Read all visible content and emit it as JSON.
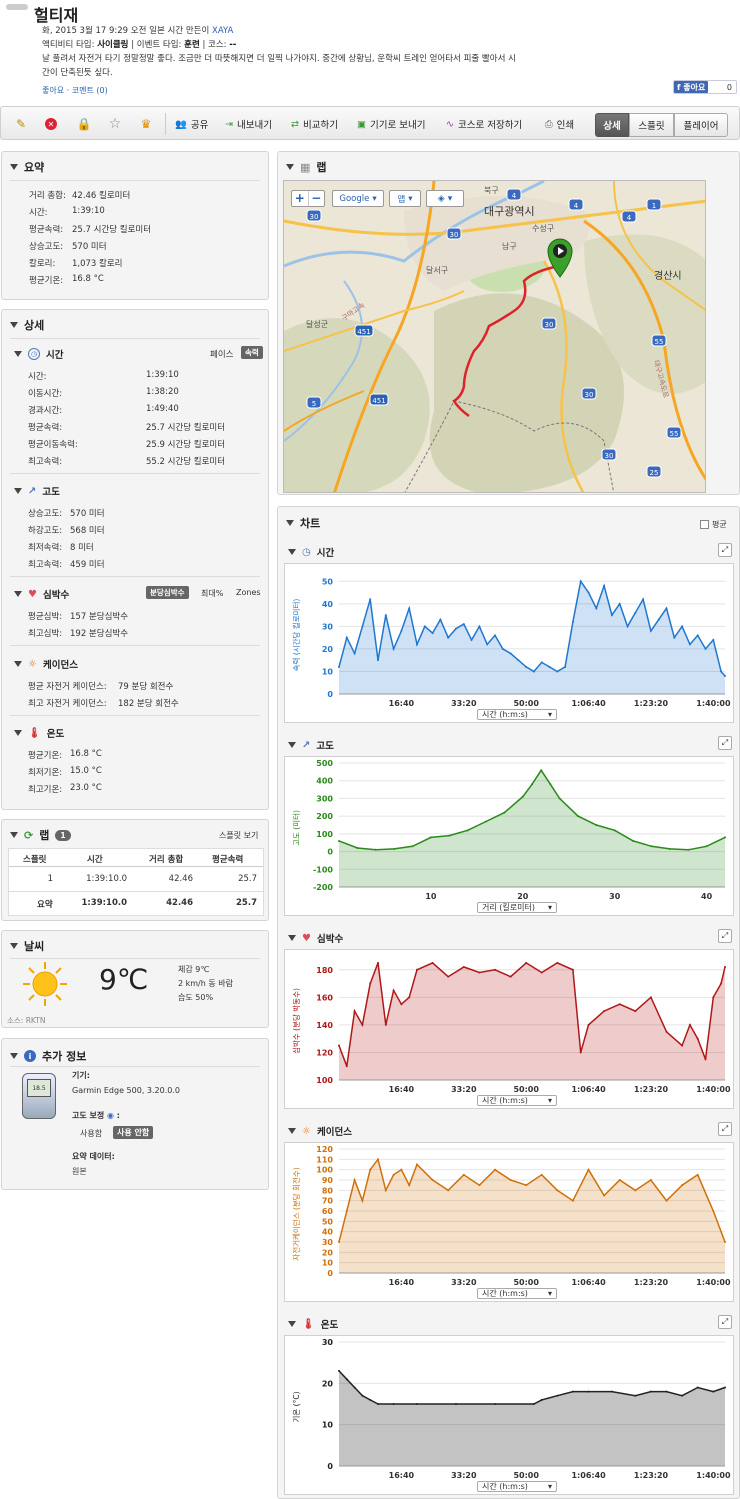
{
  "header": {
    "title": "헐티재",
    "meta_line": "화, 2015 3월 17 9:29 오전 일본 시간 만든이",
    "author": "XAYA",
    "activity_prefix": "액티비티 타입:",
    "activity_type": "사이클링",
    "event_prefix": "| 이벤트 타입:",
    "event_type": "훈련",
    "course_prefix": "| 코스:",
    "course": "--",
    "desc1": "날 풀려서 자전거 타기 정말정말 좋다. 조금만 더 따뜻해지면 더 일찍 나가야지. 중간에 상황님, 운학씨 트레인 얻어타서 피줄 빨아서 시",
    "desc2": "간이 단축된듯 싶다.",
    "like_link": "좋아요",
    "comment_link": "코멘트 (0)",
    "fb_like": "좋아요",
    "fb_count": "0"
  },
  "toolbar": {
    "share": "공유",
    "export": "내보내기",
    "compare": "비교하기",
    "send_device": "기기로 보내기",
    "save_course": "코스로 저장하기",
    "print": "인쇄",
    "tab_detail": "상세",
    "tab_split": "스플릿",
    "tab_player": "플레이어"
  },
  "summary": {
    "title": "요약",
    "rows": [
      {
        "k": "거리 총합:",
        "v": "42.46 킬로미터"
      },
      {
        "k": "시간:",
        "v": "1:39:10"
      },
      {
        "k": "평균속력:",
        "v": "25.7 시간당 킬로미터"
      },
      {
        "k": "상승고도:",
        "v": "570 미터"
      },
      {
        "k": "칼로리:",
        "v": "1,073 칼로리"
      },
      {
        "k": "평균기온:",
        "v": "16.8 °C"
      }
    ]
  },
  "details": {
    "title": "상세",
    "time": {
      "title": "시간",
      "opt1": "페이스",
      "opt2": "속력",
      "rows": [
        {
          "k": "시간:",
          "v": "1:39:10"
        },
        {
          "k": "이동시간:",
          "v": "1:38:20"
        },
        {
          "k": "경과시간:",
          "v": "1:49:40"
        },
        {
          "k": "평균속력:",
          "v": "25.7 시간당 킬로미터"
        },
        {
          "k": "평균이동속력:",
          "v": "25.9 시간당 킬로미터"
        },
        {
          "k": "최고속력:",
          "v": "55.2 시간당 킬로미터"
        }
      ]
    },
    "elev": {
      "title": "고도",
      "rows": [
        {
          "k": "상승고도:",
          "v": "570 미터"
        },
        {
          "k": "하강고도:",
          "v": "568 미터"
        },
        {
          "k": "최저속력:",
          "v": "8 미터"
        },
        {
          "k": "최고속력:",
          "v": "459 미터"
        }
      ]
    },
    "hr": {
      "title": "심박수",
      "opt1": "분당심박수",
      "opt2": "최대%",
      "opt3": "Zones",
      "rows": [
        {
          "k": "평균심박:",
          "v": "157 분당심박수"
        },
        {
          "k": "최고심박:",
          "v": "192 분당심박수"
        }
      ]
    },
    "cad": {
      "title": "케이던스",
      "rows": [
        {
          "k": "평균 자전거 케이던스:",
          "v": "79 분당 회전수"
        },
        {
          "k": "최고 자전거 케이던스:",
          "v": "182 분당 회전수"
        }
      ]
    },
    "temp": {
      "title": "온도",
      "rows": [
        {
          "k": "평균기온:",
          "v": "16.8 °C"
        },
        {
          "k": "최저기온:",
          "v": "15.0 °C"
        },
        {
          "k": "최고기온:",
          "v": "23.0 °C"
        }
      ]
    }
  },
  "laps": {
    "title": "랩",
    "count": "1",
    "split_view": "스플릿 보기",
    "headers": [
      "스플릿",
      "시간",
      "거리 총합",
      "평균속력"
    ],
    "rows": [
      [
        "1",
        "1:39:10.0",
        "42.46",
        "25.7"
      ],
      [
        "요약",
        "1:39:10.0",
        "42.46",
        "25.7"
      ]
    ]
  },
  "weather": {
    "title": "날씨",
    "temp": "9℃",
    "feels": "체감 9℃",
    "wind": "2 km/h 동 바람",
    "humidity": "습도 50%",
    "source": "소스: RKTN"
  },
  "extra": {
    "title": "추가 정보",
    "device_label": "기기:",
    "device": "Garmin Edge 500, 3.20.0.0",
    "elev_corr_label": "고도 보정",
    "elev_opt1": "사용함",
    "elev_opt2": "사용 안함",
    "summary_label": "요약 데이터:",
    "summary_value": "원본",
    "device_screen": "18.5"
  },
  "map": {
    "title": "랩",
    "btn_google": "Google",
    "btn_map": "맵",
    "labels": {
      "daegu": "대구광역시",
      "bukgu": "북구",
      "namgu": "남구",
      "susunggu": "수성구",
      "dalseogu": "달서구",
      "dalseonggun": "달성군",
      "gyeongsan": "경산시",
      "daedong": "대구고속도로",
      "gumagosok": "구마고속"
    },
    "road_nums": [
      "30",
      "30",
      "4",
      "4",
      "1",
      "451",
      "451",
      "5",
      "30",
      "30",
      "55",
      "55",
      "25",
      "30",
      "4"
    ]
  },
  "charts": {
    "title": "차트",
    "avg_label": "평균",
    "panels": [
      {
        "title": "시간",
        "ylabel": "속력 (시간당 킬로미터)",
        "xsel": "시간 (h:m:s)"
      },
      {
        "title": "고도",
        "ylabel": "고도 (미터)",
        "xsel": "거리 (킬로미터)"
      },
      {
        "title": "심박수",
        "ylabel": "심박수 (분당 박동수)",
        "xsel": "시간 (h:m:s)"
      },
      {
        "title": "케이던스",
        "ylabel": "자전거케이던스 (분당 회전수)",
        "xsel": "시간 (h:m:s)"
      },
      {
        "title": "온도",
        "ylabel": "기온 (°C)",
        "xsel": "시간 (h:m:s)"
      }
    ]
  },
  "chart_data": [
    {
      "type": "area",
      "title": "시간",
      "ylabel": "속력 (시간당 킬로미터)",
      "xlabel": "시간 (h:m:s)",
      "ylim": [
        0,
        55
      ],
      "yticks": [
        0,
        10,
        20,
        30,
        40,
        50
      ],
      "xticks": [
        "16:40",
        "33:20",
        "50:00",
        "1:06:40",
        "1:23:20",
        "1:40:00"
      ],
      "color": "#1f77d0",
      "x": [
        0,
        2,
        4,
        6,
        8,
        10,
        12,
        14,
        16,
        18,
        20,
        22,
        24,
        26,
        28,
        30,
        32,
        34,
        36,
        38,
        40,
        42,
        44,
        46,
        48,
        50,
        52,
        54,
        56,
        58,
        60,
        62,
        64,
        66,
        68,
        70,
        72,
        74,
        76,
        78,
        80,
        82,
        84,
        86,
        88,
        90,
        92,
        94,
        96,
        98,
        99
      ],
      "values": [
        12,
        25,
        18,
        30,
        42,
        15,
        35,
        20,
        28,
        38,
        22,
        30,
        27,
        33,
        25,
        29,
        31,
        24,
        30,
        22,
        26,
        20,
        18,
        15,
        12,
        10,
        14,
        12,
        10,
        12,
        32,
        50,
        45,
        38,
        48,
        35,
        40,
        30,
        36,
        42,
        28,
        33,
        38,
        25,
        30,
        22,
        26,
        20,
        24,
        10,
        8
      ]
    },
    {
      "type": "area",
      "title": "고도",
      "ylabel": "고도 (미터)",
      "xlabel": "거리 (킬로미터)",
      "ylim": [
        -200,
        500
      ],
      "yticks": [
        -200,
        -100,
        0,
        100,
        200,
        300,
        400,
        500
      ],
      "xticks": [
        10,
        20,
        30,
        40
      ],
      "color": "#2a8a1a",
      "x": [
        0,
        2,
        4,
        6,
        8,
        10,
        12,
        14,
        16,
        18,
        20,
        21,
        22,
        23,
        24,
        26,
        28,
        30,
        32,
        34,
        36,
        38,
        40,
        42
      ],
      "values": [
        60,
        20,
        10,
        15,
        30,
        80,
        90,
        120,
        170,
        220,
        310,
        380,
        459,
        380,
        300,
        200,
        150,
        120,
        60,
        30,
        15,
        10,
        30,
        80
      ]
    },
    {
      "type": "area",
      "title": "심박수",
      "ylabel": "심박수 (분당 박동수)",
      "xlabel": "시간 (h:m:s)",
      "ylim": [
        100,
        190
      ],
      "yticks": [
        100,
        120,
        140,
        160,
        180
      ],
      "xticks": [
        "16:40",
        "33:20",
        "50:00",
        "1:06:40",
        "1:23:20",
        "1:40:00"
      ],
      "color": "#b01818",
      "x": [
        0,
        2,
        4,
        6,
        8,
        10,
        12,
        14,
        16,
        18,
        20,
        24,
        28,
        32,
        36,
        40,
        44,
        48,
        52,
        56,
        60,
        62,
        64,
        68,
        72,
        76,
        80,
        84,
        88,
        90,
        92,
        94,
        96,
        98,
        99
      ],
      "values": [
        125,
        110,
        150,
        140,
        170,
        185,
        140,
        165,
        155,
        160,
        180,
        185,
        175,
        182,
        178,
        180,
        175,
        185,
        178,
        185,
        180,
        120,
        140,
        150,
        155,
        150,
        160,
        135,
        125,
        140,
        130,
        115,
        160,
        170,
        182
      ]
    },
    {
      "type": "area",
      "title": "케이던스",
      "ylabel": "자전거케이던스 (분당 회전수)",
      "xlabel": "시간 (h:m:s)",
      "ylim": [
        0,
        120
      ],
      "yticks": [
        0,
        10,
        20,
        30,
        40,
        50,
        60,
        70,
        80,
        90,
        100,
        110,
        120
      ],
      "xticks": [
        "16:40",
        "33:20",
        "50:00",
        "1:06:40",
        "1:23:20",
        "1:40:00"
      ],
      "color": "#d0700a",
      "x": [
        0,
        2,
        4,
        6,
        8,
        10,
        12,
        14,
        16,
        18,
        20,
        24,
        28,
        32,
        36,
        40,
        44,
        48,
        52,
        56,
        60,
        64,
        68,
        72,
        76,
        80,
        84,
        88,
        92,
        96,
        99
      ],
      "values": [
        30,
        60,
        90,
        70,
        100,
        110,
        80,
        95,
        100,
        85,
        105,
        90,
        80,
        95,
        85,
        100,
        90,
        85,
        95,
        80,
        70,
        100,
        75,
        90,
        80,
        90,
        70,
        85,
        95,
        60,
        30
      ]
    },
    {
      "type": "area",
      "title": "온도",
      "ylabel": "기온 (°C)",
      "xlabel": "시간 (h:m:s)",
      "ylim": [
        0,
        30
      ],
      "yticks": [
        0,
        10,
        20,
        30
      ],
      "xticks": [
        "16:40",
        "33:20",
        "50:00",
        "1:06:40",
        "1:23:20",
        "1:40:00"
      ],
      "color": "#222222",
      "x": [
        0,
        2,
        4,
        6,
        8,
        10,
        14,
        20,
        30,
        40,
        50,
        52,
        56,
        60,
        64,
        70,
        76,
        80,
        84,
        88,
        92,
        96,
        99
      ],
      "values": [
        23,
        21,
        19,
        17,
        16,
        15,
        15,
        15,
        15,
        15,
        15,
        16,
        17,
        18,
        18,
        18,
        17,
        18,
        18,
        17,
        19,
        18,
        19
      ]
    }
  ]
}
